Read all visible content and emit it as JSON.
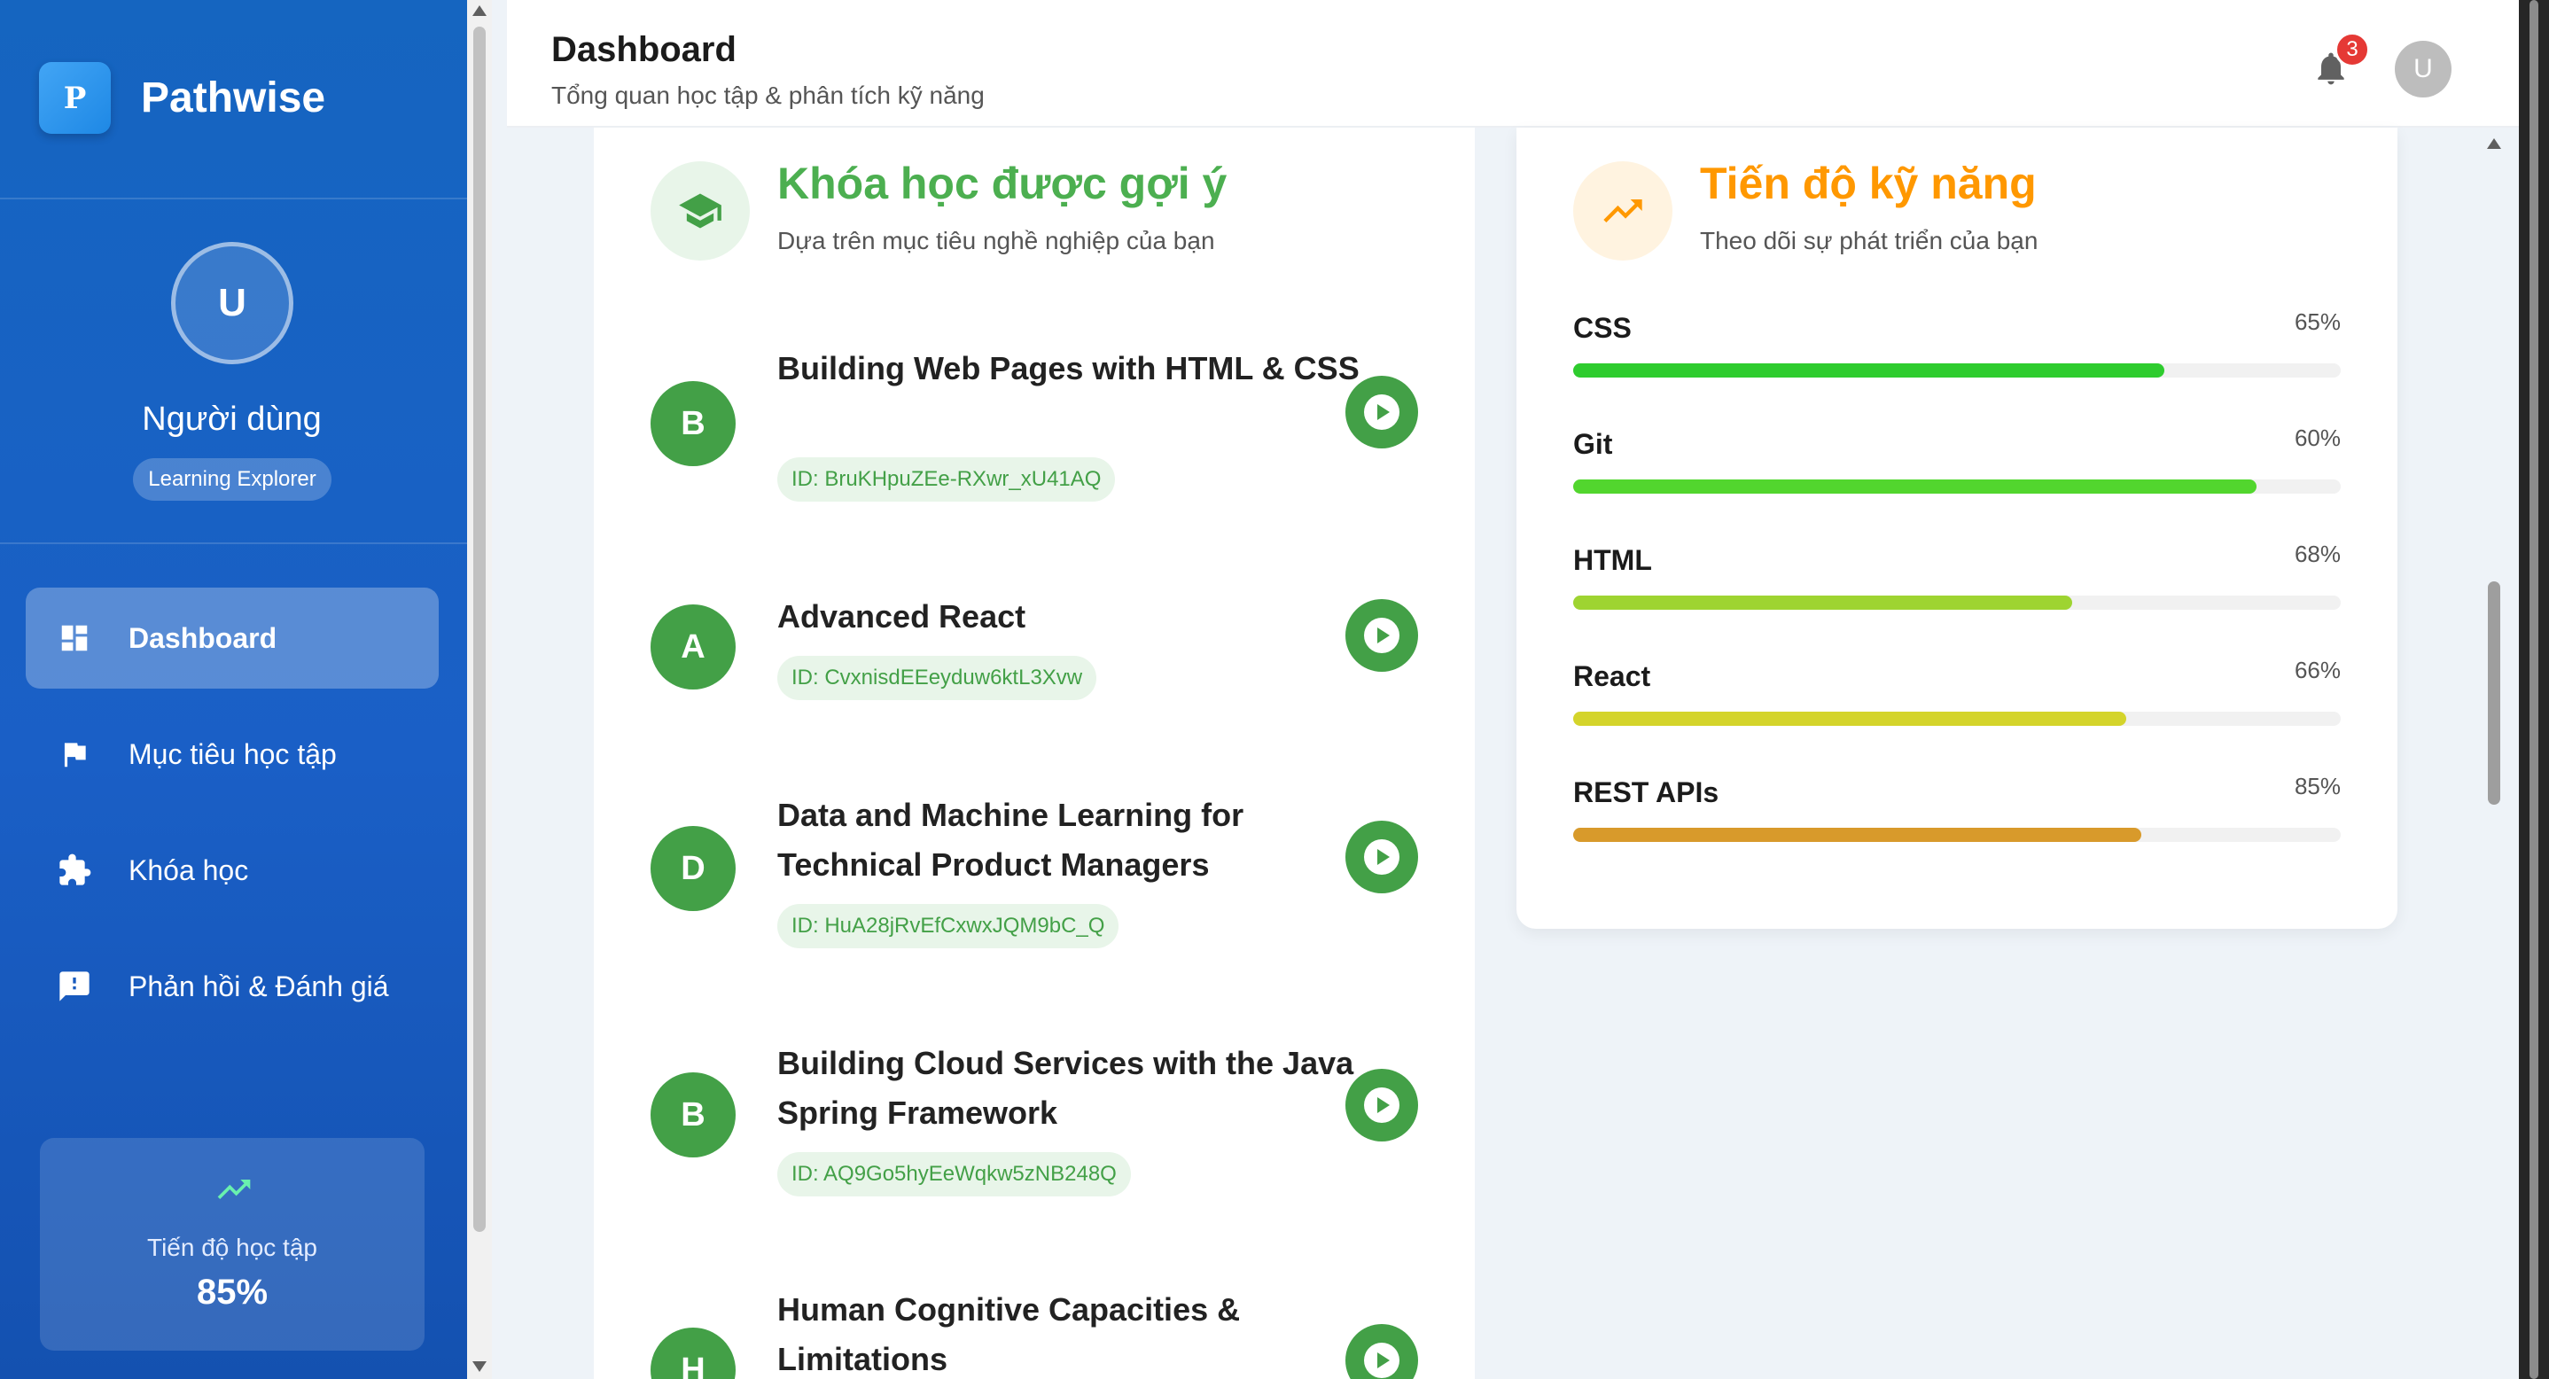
{
  "brand": {
    "logo_letter": "P",
    "name": "Pathwise"
  },
  "profile": {
    "avatar_letter": "U",
    "name": "Người dùng",
    "role": "Learning Explorer"
  },
  "nav": {
    "items": [
      {
        "label": "Dashboard",
        "icon": "dashboard-icon",
        "active": true
      },
      {
        "label": "Mục tiêu học tập",
        "icon": "flag-icon",
        "active": false
      },
      {
        "label": "Khóa học",
        "icon": "puzzle-icon",
        "active": false
      },
      {
        "label": "Phản hồi & Đánh giá",
        "icon": "feedback-icon",
        "active": false
      }
    ]
  },
  "sidebar_progress": {
    "label": "Tiến độ học tập",
    "value": "85%",
    "icon": "trending-up-icon"
  },
  "header": {
    "title": "Dashboard",
    "subtitle": "Tổng quan học tập & phân tích kỹ năng",
    "notification_count": "3",
    "avatar_letter": "U"
  },
  "courses": {
    "title": "Khóa học được gợi ý",
    "subtitle": "Dựa trên mục tiêu nghề nghiệp của bạn",
    "accent": "#4caf50",
    "items": [
      {
        "letter": "B",
        "title": "Building Web Pages with HTML & CSS",
        "id": "ID: BruKHpuZEe-RXwr_xU41AQ"
      },
      {
        "letter": "A",
        "title": "Advanced React",
        "id": "ID: CvxnisdEEeyduw6ktL3Xvw"
      },
      {
        "letter": "D",
        "title": "Data and Machine Learning for Technical Product Managers",
        "id": "ID: HuA28jRvEfCxwxJQM9bC_Q"
      },
      {
        "letter": "B",
        "title": "Building Cloud Services with the Java Spring Framework",
        "id": "ID: AQ9Go5hyEeWqkw5zNB248Q"
      },
      {
        "letter": "H",
        "title": "Human Cognitive Capacities & Limitations",
        "id": ""
      }
    ]
  },
  "skills": {
    "title": "Tiến độ kỹ năng",
    "subtitle": "Theo dõi sự phát triển của bạn",
    "accent": "#ff9800",
    "items": [
      {
        "name": "CSS",
        "percent_label": "65%",
        "bar_fraction": 0.77,
        "color": "#2ecc2e"
      },
      {
        "name": "Git",
        "percent_label": "60%",
        "bar_fraction": 0.89,
        "color": "#52d62e"
      },
      {
        "name": "HTML",
        "percent_label": "68%",
        "bar_fraction": 0.65,
        "color": "#9ed431"
      },
      {
        "name": "React",
        "percent_label": "66%",
        "bar_fraction": 0.72,
        "color": "#d4d42b"
      },
      {
        "name": "REST APIs",
        "percent_label": "85%",
        "bar_fraction": 0.74,
        "color": "#d89a2b"
      }
    ]
  }
}
